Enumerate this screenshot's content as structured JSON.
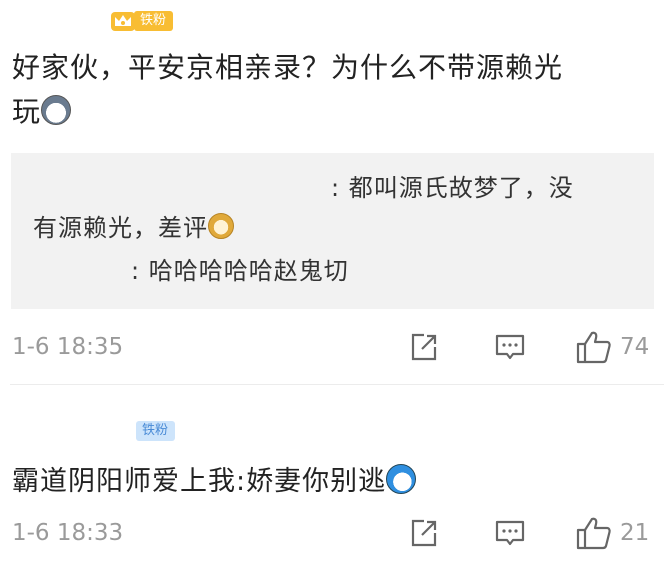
{
  "comments": [
    {
      "badge": "铁粉",
      "badge_style": "gold-crown",
      "text_line1": "好家伙，平安京相亲录？为什么不带源赖光",
      "text_line2": "玩",
      "emoji": "husky-emoji",
      "replies": [
        {
          "line1": ": 都叫源氏故梦了，没",
          "line2": "有源赖光，差评",
          "emoji": "doge-emoji"
        },
        {
          "line1": ": 哈哈哈哈哈赵鬼切"
        }
      ],
      "time": "1-6 18:35",
      "likes": "74"
    },
    {
      "badge": "铁粉",
      "badge_style": "blue",
      "text": "霸道阴阳师爱上我:娇妻你别逃",
      "emoji": "doraemon-emoji",
      "time": "1-6 18:33",
      "likes": "21"
    }
  ],
  "colors": {
    "gold_badge": "#f8bd33",
    "blue_badge_bg": "#cde4fb",
    "blue_badge_text": "#4a8bd6",
    "meta_gray": "#9a9a9a",
    "reply_bg": "#f2f2f2"
  }
}
